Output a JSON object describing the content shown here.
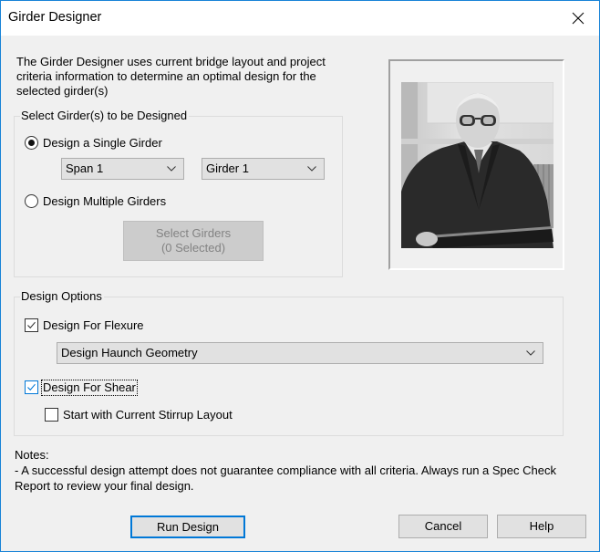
{
  "window": {
    "title": "Girder Designer",
    "close_icon": "close-icon",
    "border_color": "#1883d7"
  },
  "intro": {
    "text": "The Girder Designer uses current bridge layout and project criteria information to determine an optimal design for the selected girder(s)"
  },
  "select_girders_group": {
    "legend": "Select Girder(s) to be Designed",
    "single": {
      "label": "Design a Single Girder",
      "checked": true
    },
    "span_combo": {
      "value": "Span 1"
    },
    "girder_combo": {
      "value": "Girder 1"
    },
    "multiple": {
      "label": "Design Multiple Girders",
      "checked": false
    },
    "select_button": {
      "line1": "Select Girders",
      "line2": "(0 Selected)",
      "enabled": false
    }
  },
  "picture": {
    "description": "Black and white portrait photo of an elderly man with glasses in a suit holding a document"
  },
  "design_options_group": {
    "legend": "Design Options",
    "flexure": {
      "label": "Design For Flexure",
      "checked": true
    },
    "flexure_combo": {
      "value": "Design Haunch Geometry"
    },
    "shear": {
      "label": "Design For Shear",
      "checked": true,
      "focused": true
    },
    "stirrup": {
      "label": "Start with Current Stirrup Layout",
      "checked": false
    }
  },
  "notes": {
    "heading": "Notes:",
    "text": "- A successful design attempt does not guarantee compliance with all criteria.  Always run a Spec Check Report to review your final design."
  },
  "buttons": {
    "run": "Run Design",
    "cancel": "Cancel",
    "help": "Help"
  },
  "colors": {
    "accent": "#0078d7",
    "dialog_bg": "#f0f0f0",
    "button_bg": "#e1e1e1",
    "disabled_text": "#838383"
  }
}
